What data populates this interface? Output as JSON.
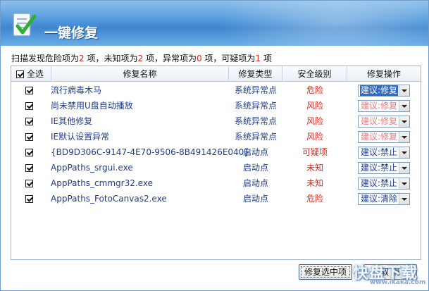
{
  "header": {
    "title": "一键修复"
  },
  "summary": {
    "prefix": "扫描发现危险项为",
    "danger_count": "2",
    "unit1": " 项，未知项为",
    "unknown_count": "2",
    "unit2": " 项，异常项为",
    "abnormal_count": "0",
    "unit3": " 项，可疑项为",
    "suspicious_count": "1",
    "unit4": " 项"
  },
  "table": {
    "select_all_label": "全选",
    "columns": [
      "修复名称",
      "修复类型",
      "安全级别",
      "修复操作"
    ],
    "rows": [
      {
        "name": "流行病毒木马",
        "type": "系统异常点",
        "level": "危险",
        "action": "建议:修复",
        "action_state": "active"
      },
      {
        "name": "尚未禁用U盘自动播放",
        "type": "系统异常点",
        "level": "风险",
        "action": "建议:修复",
        "action_state": "pink"
      },
      {
        "name": "IE其他修复",
        "type": "系统异常点",
        "level": "风险",
        "action": "建议:修复",
        "action_state": "pink"
      },
      {
        "name": "IE默认设置异常",
        "type": "系统异常点",
        "level": "风险",
        "action": "建议:修复",
        "action_state": "pink"
      },
      {
        "name": "{BD9D306C-9147-4E70-9506-8B491426E040}",
        "type": "启动点",
        "level": "可疑项",
        "action": "建议:禁止",
        "action_state": "blue"
      },
      {
        "name": "AppPaths_srgui.exe",
        "type": "启动点",
        "level": "未知",
        "action": "建议:禁止",
        "action_state": "blue"
      },
      {
        "name": "AppPaths_cmmgr32.exe",
        "type": "启动点",
        "level": "未知",
        "action": "建议:禁止",
        "action_state": "blue"
      },
      {
        "name": "AppPaths_FotoCanvas2.exe",
        "type": "启动点",
        "level": "危险",
        "action": "建议:清除",
        "action_state": "blue"
      }
    ]
  },
  "buttons": {
    "fix_selected": "修复选中项",
    "cancel": "取 消"
  },
  "watermark": {
    "big": "快盘下载",
    "small": "www.ikaka.com"
  },
  "colors": {
    "danger": "#d42a1f",
    "text_blue": "#1f3c8c",
    "header_blue": "#4f97da"
  }
}
